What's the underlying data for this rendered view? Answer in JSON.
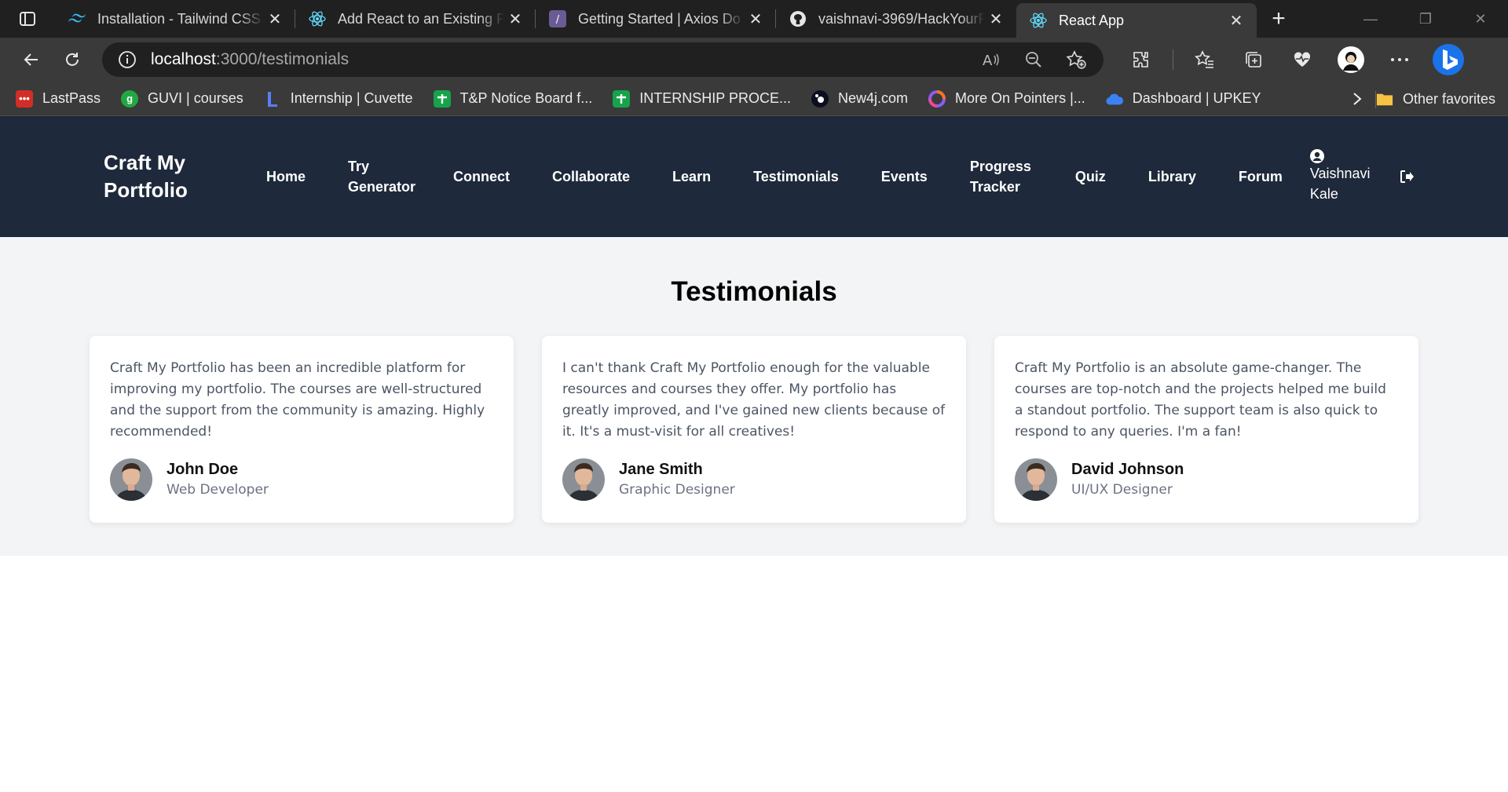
{
  "browser": {
    "tabs": [
      {
        "title": "Installation - Tailwind CSS",
        "icon": "tailwind-icon",
        "active": false
      },
      {
        "title": "Add React to an Existing P",
        "icon": "react-icon",
        "active": false
      },
      {
        "title": "Getting Started | Axios Do",
        "icon": "axios-icon",
        "active": false
      },
      {
        "title": "vaishnavi-3969/HackYourP",
        "icon": "github-icon",
        "active": false
      },
      {
        "title": "React App",
        "icon": "react-icon",
        "active": true
      }
    ],
    "address": {
      "host": "localhost",
      "path": ":3000/testimonials"
    },
    "bookmarks": [
      {
        "label": "LastPass",
        "icon": "lastpass-icon",
        "color": "#d32d27"
      },
      {
        "label": "GUVI | courses",
        "icon": "guvi-icon",
        "color": "#22a843"
      },
      {
        "label": "Internship | Cuvette",
        "icon": "cuvette-icon",
        "color": "#3b5bdb"
      },
      {
        "label": "T&P Notice Board f...",
        "icon": "sheets-icon",
        "color": "#16a34a"
      },
      {
        "label": "INTERNSHIP PROCE...",
        "icon": "sheets-icon",
        "color": "#16a34a"
      },
      {
        "label": "New4j.com",
        "icon": "neo4j-icon",
        "color": "#0b1020"
      },
      {
        "label": "More On Pointers |...",
        "icon": "pointers-icon",
        "color": "#8b5cf6"
      },
      {
        "label": "Dashboard | UPKEY",
        "icon": "upkey-icon",
        "color": "#3b82f6"
      }
    ],
    "other_favorites": "Other favorites"
  },
  "app": {
    "brand_line1": "Craft My",
    "brand_line2": "Portfolio",
    "nav": {
      "home": "Home",
      "try_line1": "Try",
      "try_line2": "Generator",
      "connect": "Connect",
      "collaborate": "Collaborate",
      "learn": "Learn",
      "testimonials": "Testimonials",
      "events": "Events",
      "progress_line1": "Progress",
      "progress_line2": "Tracker",
      "quiz": "Quiz",
      "library": "Library",
      "forum": "Forum"
    },
    "user": {
      "first": "Vaishnavi",
      "last": "Kale"
    }
  },
  "page": {
    "title": "Testimonials",
    "testimonials": [
      {
        "quote": "Craft My Portfolio has been an incredible platform for improving my portfolio. The courses are well-structured and the support from the community is amazing. Highly recommended!",
        "name": "John Doe",
        "role": "Web Developer"
      },
      {
        "quote": "I can't thank Craft My Portfolio enough for the valuable resources and courses they offer. My portfolio has greatly improved, and I've gained new clients because of it. It's a must-visit for all creatives!",
        "name": "Jane Smith",
        "role": "Graphic Designer"
      },
      {
        "quote": "Craft My Portfolio is an absolute game-changer. The courses are top-notch and the projects helped me build a standout portfolio. The support team is also quick to respond to any queries. I'm a fan!",
        "name": "David Johnson",
        "role": "UI/UX Designer"
      }
    ]
  }
}
